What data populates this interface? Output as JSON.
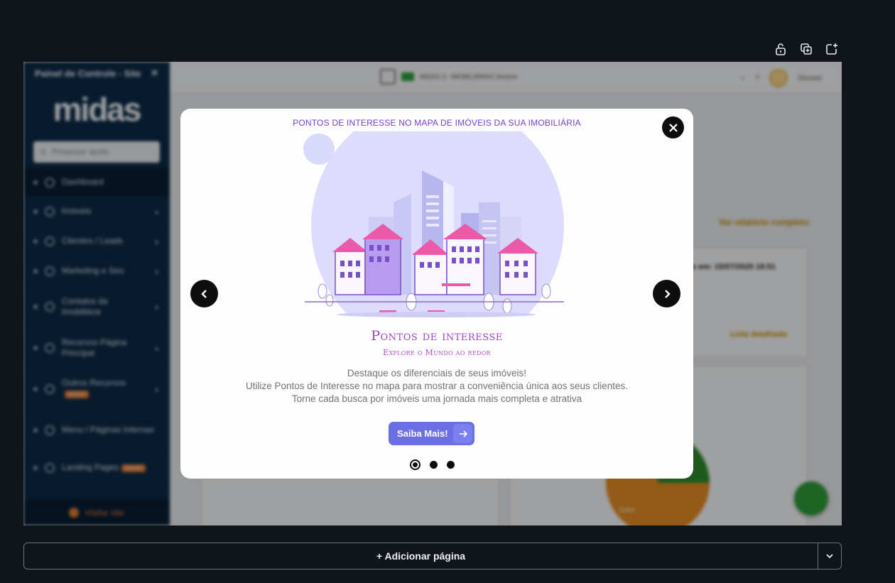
{
  "editor": {
    "toolbar_icons": [
      "unlock-icon",
      "duplicate-icon",
      "external-icon"
    ],
    "add_page_label": "+ Adicionar página"
  },
  "background_app": {
    "sidebar": {
      "title": "Painel de Controle - Site",
      "logo": "midas",
      "search_placeholder": "Pesquisar ajuda",
      "items": [
        {
          "label": "Dashboard",
          "icon": "dashboard-icon"
        },
        {
          "label": "Imóveis",
          "icon": "home-icon"
        },
        {
          "label": "Clientes / Leads",
          "icon": "user-icon"
        },
        {
          "label": "Marketing e Seo",
          "icon": "chart-icon"
        },
        {
          "label": "Contatos da Imobiliária",
          "icon": "phone-icon"
        },
        {
          "label": "Recursos Página Principal",
          "icon": "globe-icon"
        },
        {
          "label": "Outros Recursos",
          "icon": "box-icon",
          "badge": "NOVO"
        },
        {
          "label": "Menu / Páginas Internas",
          "icon": "layout-icon"
        },
        {
          "label": "Landing Pages",
          "icon": "page-icon",
          "badge": "NOVO"
        }
      ],
      "visit_label": "Visitar site"
    },
    "topbar": {
      "plan": "MIDAS 3 - IMOBILIÁRIAS Simone",
      "user": "Simone"
    },
    "content": {
      "report_link": "Ver relatório completo",
      "card_text": "s em: 15/07/2025 18:51",
      "list_link": "Lista detalhada",
      "pie_label": "Outro",
      "pie_colors": [
        "#2e8b2e",
        "#e38a25"
      ]
    }
  },
  "modal": {
    "header": "PONTOS DE INTERESSE NO MAPA DE IMÓVEIS DA SUA IMOBILIÁRIA",
    "title": "Pontos de interesse",
    "subtitle": "Explore o Mundo ao redor",
    "description": [
      "Destaque os diferenciais de seus imóveis!",
      "Utilize Pontos de Interesse no mapa para mostrar a conveniência única aos seus clientes.",
      "Torne cada busca por imóveis uma jornada mais completa e atrativa"
    ],
    "cta_label": "Saiba Mais!",
    "slides": 3,
    "active_slide": 1,
    "accent": "#9d47c9",
    "button_color": "#6b6fe4"
  }
}
